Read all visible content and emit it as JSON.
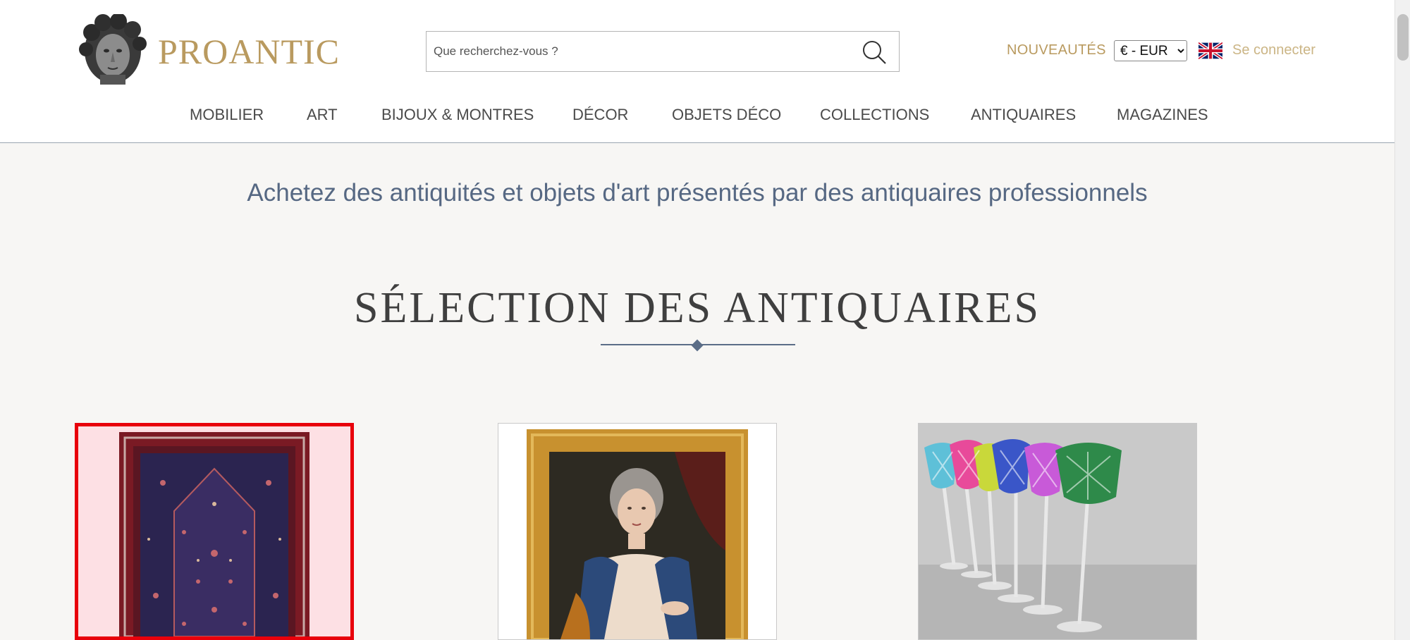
{
  "header": {
    "logo_text": "PROANTIC",
    "search": {
      "placeholder": "Que recherchez-vous ?"
    },
    "new_label": "NOUVEAUTÉS",
    "currency": "€ - EUR",
    "login_label": "Se connecter"
  },
  "nav": {
    "items": [
      {
        "label": "MOBILIER"
      },
      {
        "label": "ART"
      },
      {
        "label": "BIJOUX & MONTRES"
      },
      {
        "label": "DÉCOR"
      },
      {
        "label": "OBJETS DÉCO"
      },
      {
        "label": "COLLECTIONS"
      },
      {
        "label": "ANTIQUAIRES"
      },
      {
        "label": "MAGAZINES"
      }
    ]
  },
  "main": {
    "tagline": "Achetez des antiquités et objets d'art présentés par des antiquaires professionnels",
    "section_title": "SÉLECTION DES ANTIQUAIRES"
  },
  "products": [
    {
      "image": "persian-rug",
      "selected": true
    },
    {
      "image": "portrait-painting"
    },
    {
      "image": "crystal-wine-glasses"
    }
  ],
  "colors": {
    "gold": "#b99a5f",
    "nav_text": "#4a4a4a",
    "tagline": "#566883",
    "background": "#f7f6f4",
    "highlight": "#e8000b"
  }
}
